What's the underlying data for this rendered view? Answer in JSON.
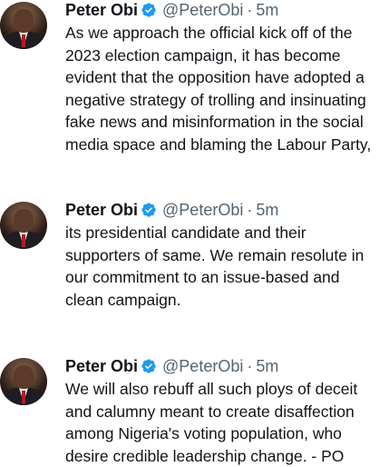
{
  "tweets": [
    {
      "author": "Peter Obi",
      "handle": "@PeterObi",
      "separator": "·",
      "time": "5m",
      "lines": [
        "As we approach the official kick off of the",
        "2023 election campaign, it has become",
        "evident that the opposition have adopted a",
        "negative strategy of trolling and insinuating",
        "fake news and misinformation in the social",
        "media space and blaming the Labour Party,"
      ]
    },
    {
      "author": "Peter Obi",
      "handle": "@PeterObi",
      "separator": "·",
      "time": "5m",
      "lines": [
        "its presidential candidate and their",
        "supporters of same. We remain resolute in",
        "our commitment to an issue-based and",
        "clean campaign."
      ]
    },
    {
      "author": "Peter Obi",
      "handle": "@PeterObi",
      "separator": "·",
      "time": "5m",
      "lines": [
        "We will also rebuff all such ploys of deceit",
        "and calumny meant to create disaffection",
        "among Nigeria's voting population, who",
        "desire credible leadership change. - PO"
      ]
    }
  ],
  "colors": {
    "verified_badge": "#1d9bf0",
    "secondary_text": "#536471",
    "primary_text": "#0f1419"
  },
  "icons": {
    "verified": "verified-badge-icon",
    "avatar": "profile-photo"
  }
}
